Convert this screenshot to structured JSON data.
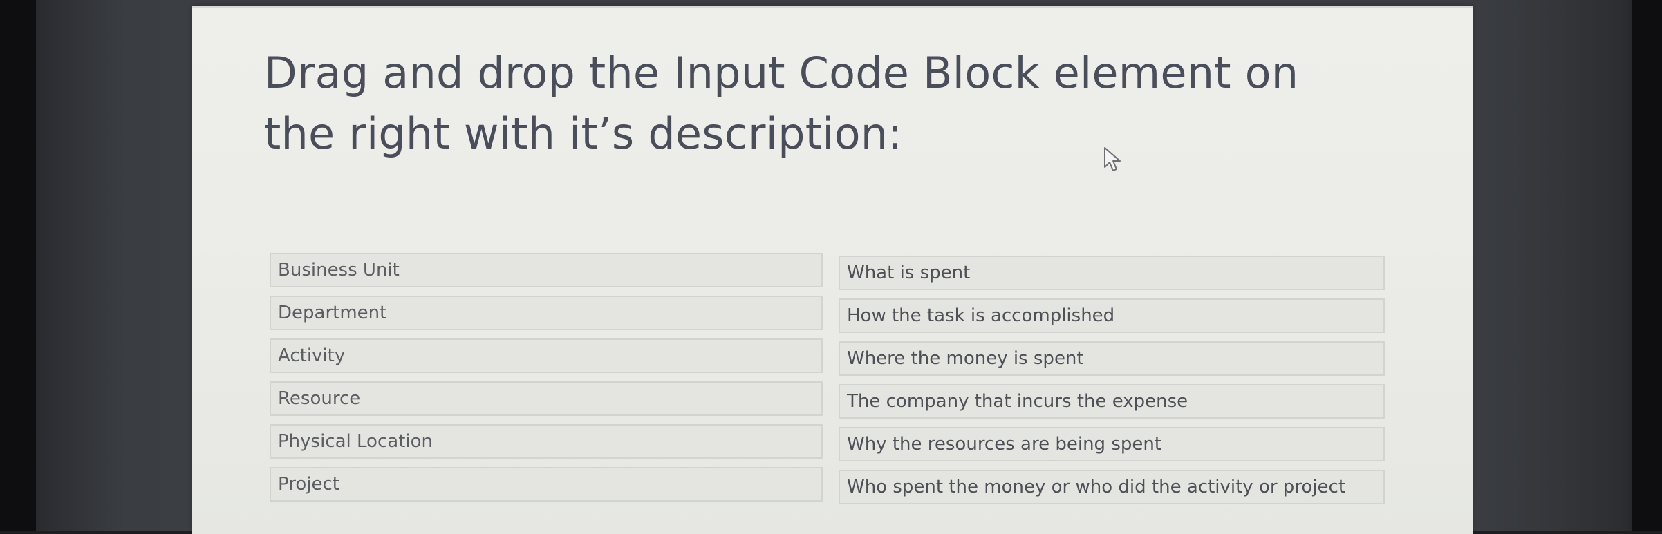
{
  "question": {
    "text": "Drag and drop the Input Code Block element on the right with it’s description:"
  },
  "terms": [
    "Business Unit",
    "Department",
    "Activity",
    "Resource",
    "Physical Location",
    "Project"
  ],
  "descriptions": [
    "What is spent",
    "How the task is accomplished",
    "Where the money is spent",
    "The company that incurs the expense",
    "Why the resources are being spent",
    "Who spent the money or who did the activity or project"
  ],
  "icons": {
    "cursor": "mouse-pointer-icon"
  }
}
